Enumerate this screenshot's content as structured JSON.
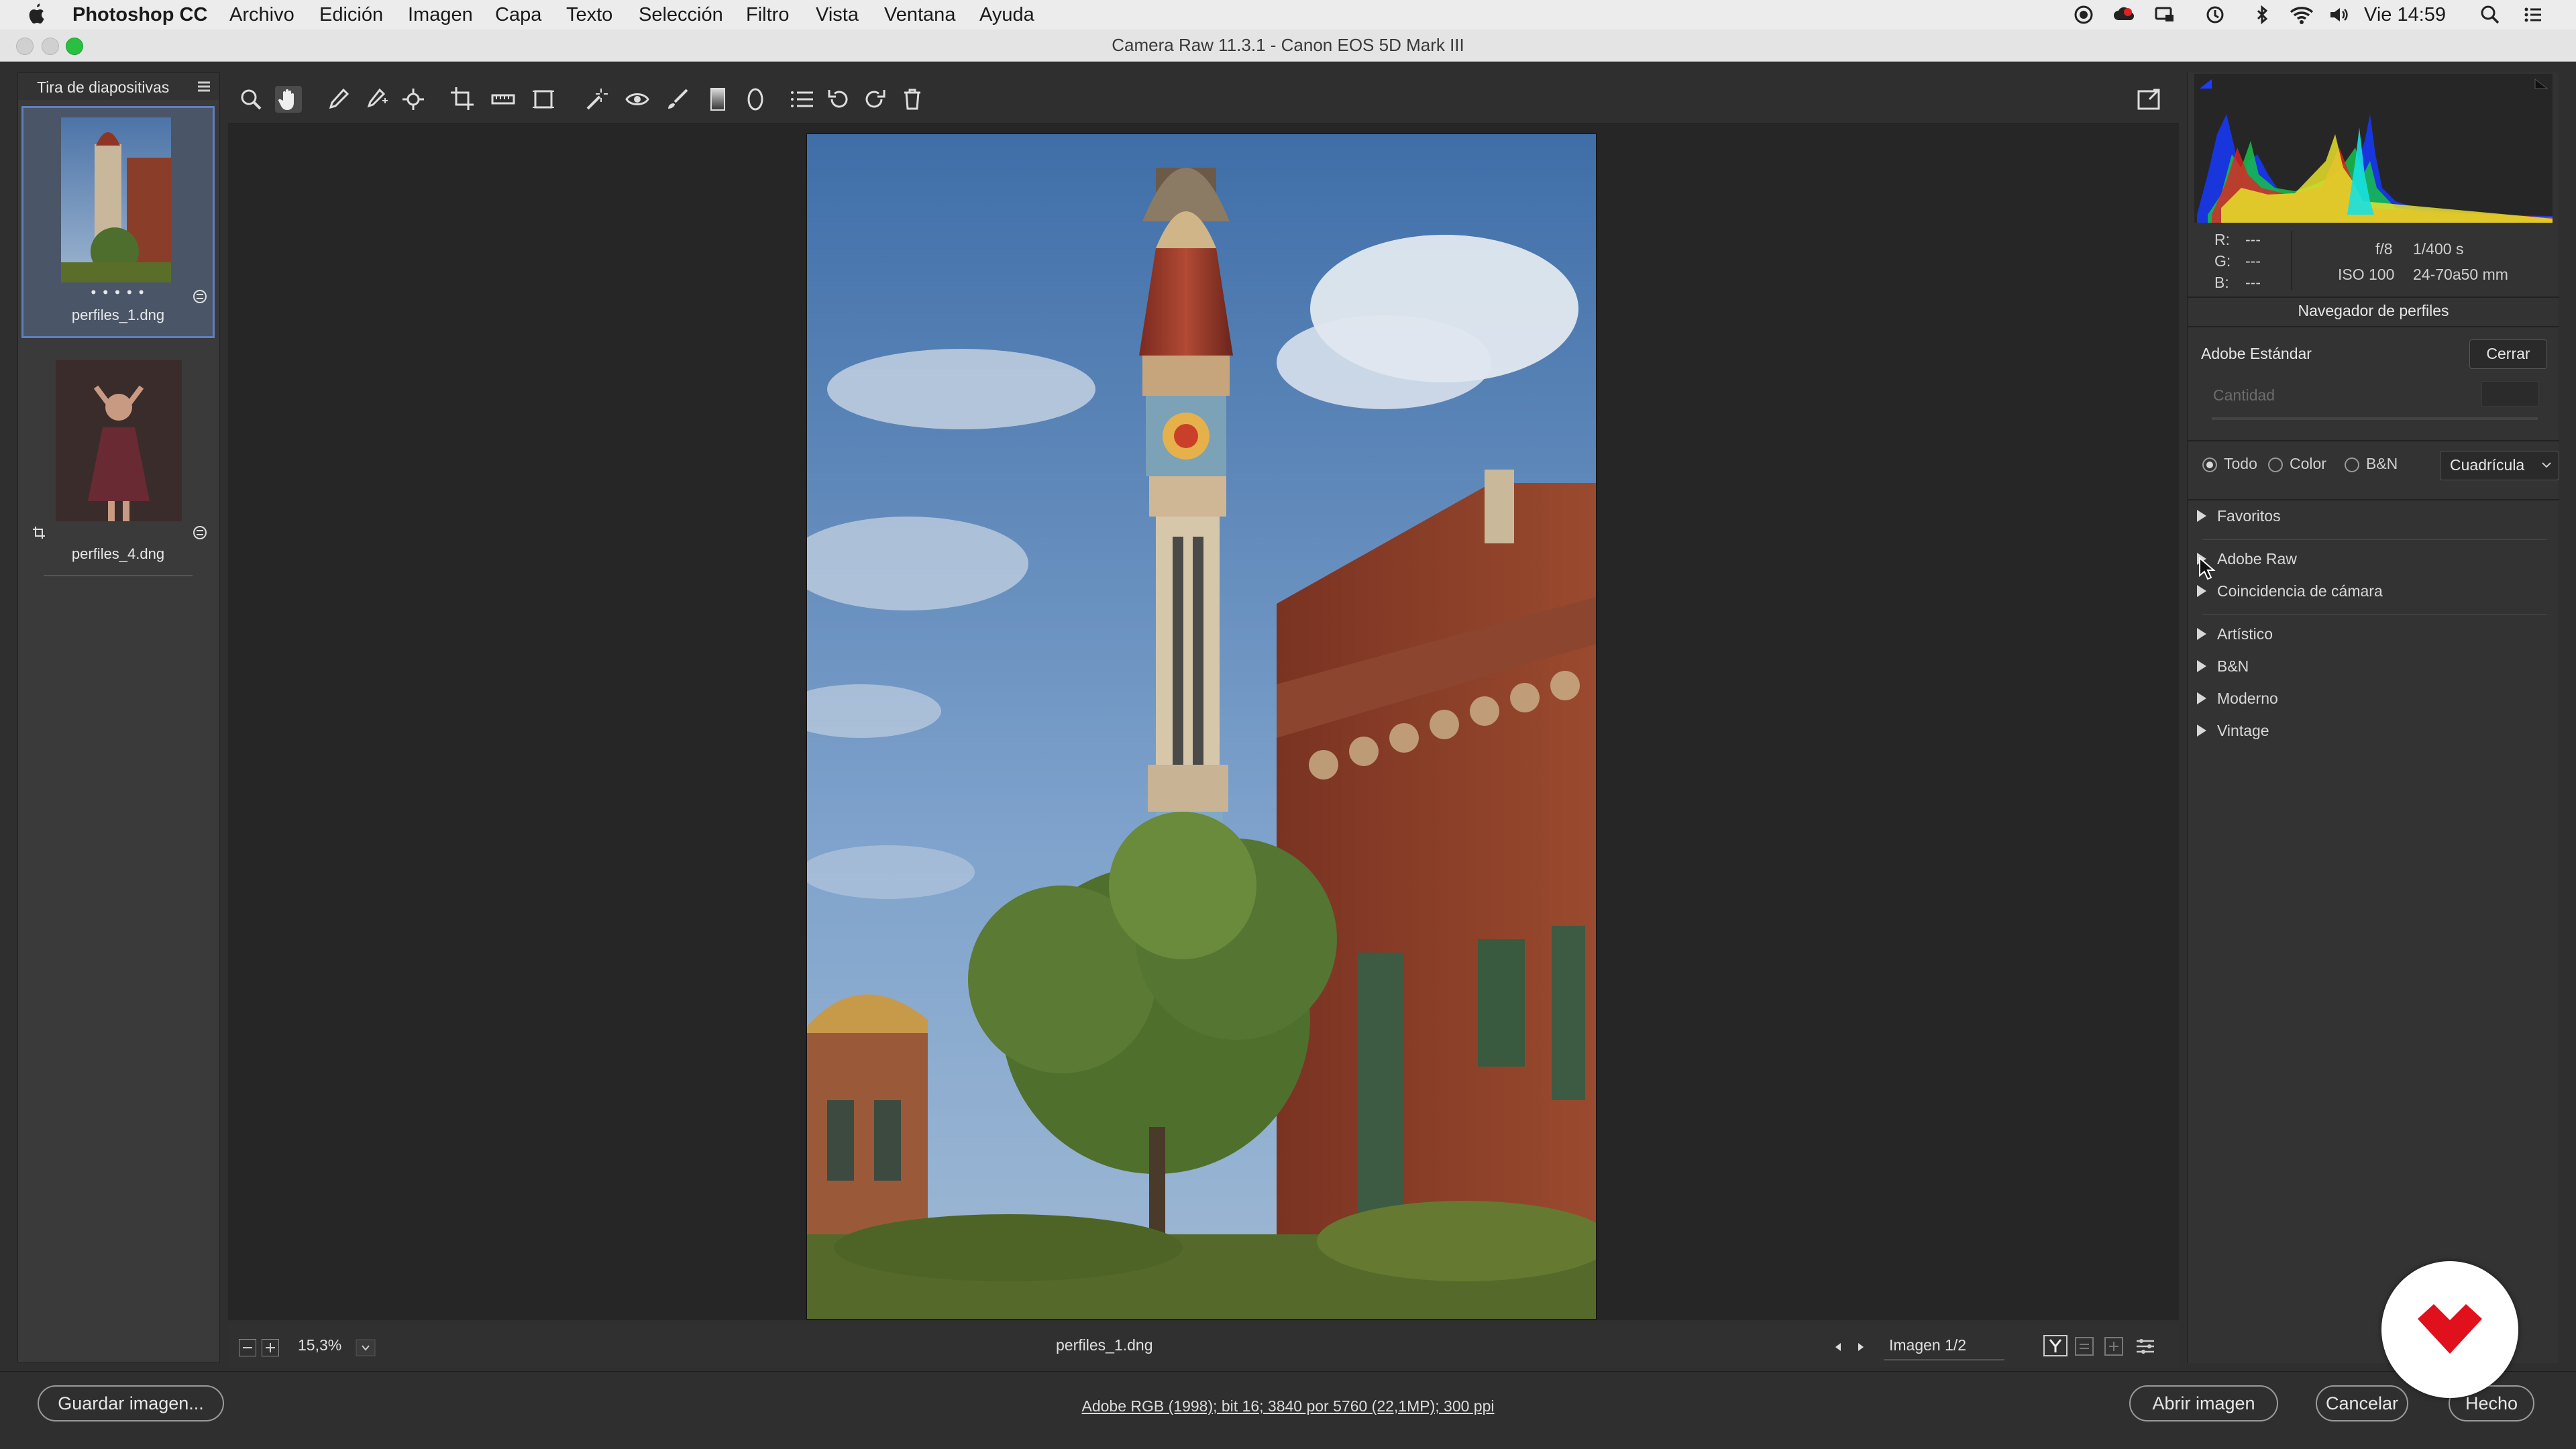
{
  "menubar": {
    "app_name": "Photoshop CC",
    "items": [
      "Archivo",
      "Edición",
      "Imagen",
      "Capa",
      "Texto",
      "Selección",
      "Filtro",
      "Vista",
      "Ventana",
      "Ayuda"
    ],
    "clock": "Vie 14:59"
  },
  "window": {
    "title": "Camera Raw 11.3.1 -  Canon EOS 5D Mark III"
  },
  "filmstrip": {
    "title": "Tira de diapositivas",
    "items": [
      {
        "name": "perfiles_1.dng",
        "rating_dots": "• • • • •"
      },
      {
        "name": "perfiles_4.dng"
      }
    ]
  },
  "toolbar": {
    "tools": [
      "zoom-icon",
      "hand-icon",
      "white-balance-icon",
      "color-sampler-icon",
      "targeted-adjust-icon",
      "crop-icon",
      "straighten-icon",
      "transform-icon",
      "spot-removal-icon",
      "red-eye-icon",
      "adjustment-brush-icon",
      "graduated-filter-icon",
      "radial-filter-icon",
      "presets-icon",
      "rotate-ccw-icon",
      "rotate-cw-icon",
      "trash-icon"
    ]
  },
  "preview_bar": {
    "zoom": "15,3%",
    "filename": "perfiles_1.dng",
    "image_counter": "Imagen 1/2"
  },
  "info_panel": {
    "r_label": "R:",
    "r_value": "---",
    "g_label": "G:",
    "g_value": "---",
    "b_label": "B:",
    "b_value": "---",
    "aperture": "f/8",
    "shutter": "1/400 s",
    "iso": "ISO 100",
    "lens": "24-70a50 mm"
  },
  "profile_browser": {
    "title": "Navegador de perfiles",
    "current_profile": "Adobe Estándar",
    "close_label": "Cerrar",
    "amount_label": "Cantidad",
    "filters": [
      {
        "label": "Todo",
        "selected": true
      },
      {
        "label": "Color",
        "selected": false
      },
      {
        "label": "B&N",
        "selected": false
      }
    ],
    "view_mode": "Cuadrícula",
    "groups": [
      "Favoritos",
      "Adobe Raw",
      "Coincidencia de cámara",
      "Artístico",
      "B&N",
      "Moderno",
      "Vintage"
    ]
  },
  "bottom": {
    "save_label": "Guardar imagen...",
    "workflow_text": "Adobe RGB (1998); bit 16; 3840 por 5760 (22,1MP); 300 ppi",
    "open_label": "Abrir imagen",
    "cancel_label": "Cancelar",
    "done_label": "Hecho"
  },
  "colors": {
    "panel_bg": "#333333",
    "selection_blue": "#5d7fc0",
    "brand_red": "#e0101c"
  }
}
